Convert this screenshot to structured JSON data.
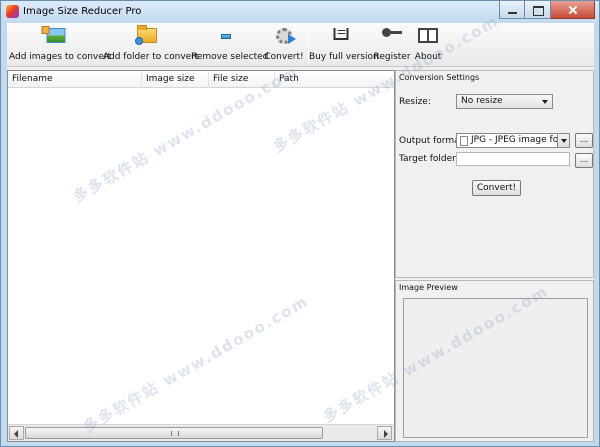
{
  "window": {
    "title": "Image Size Reducer Pro"
  },
  "toolbar": {
    "items": [
      {
        "label": "Add images to convert",
        "icon": "add-images-icon"
      },
      {
        "label": "Add folder to convert",
        "icon": "add-folder-icon"
      },
      {
        "label": "Remove selected",
        "icon": "remove-icon"
      },
      {
        "label": "Convert!",
        "icon": "convert-gear-icon"
      },
      {
        "label": "Buy full version",
        "icon": "cart-icon"
      },
      {
        "label": "Register",
        "icon": "key-icon"
      },
      {
        "label": "About",
        "icon": "book-icon"
      }
    ]
  },
  "filelist": {
    "columns": [
      "Filename",
      "Image size",
      "File size",
      "Path"
    ]
  },
  "settings": {
    "title": "Conversion Settings",
    "resize_label": "Resize:",
    "resize_value": "No resize",
    "output_format_label": "Output format:",
    "output_format_value": "JPG - JPEG image form",
    "target_folder_label": "Target folder:",
    "target_folder_value": "",
    "browse_label": "...",
    "convert_label": "Convert!"
  },
  "preview": {
    "title": "Image Preview"
  },
  "watermark": {
    "text": "多多软件站 www.ddooo.com"
  }
}
